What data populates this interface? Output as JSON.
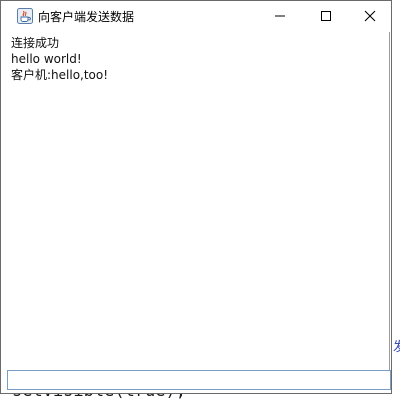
{
  "window": {
    "title": "向客户端发送数据",
    "icon": "java-cup-icon"
  },
  "titlebar_buttons": {
    "minimize": "minimize-icon",
    "maximize": "maximize-icon",
    "close": "close-icon"
  },
  "messages": [
    "连接成功",
    "hello world!",
    "客户机:hello,too!"
  ],
  "input": {
    "value": "",
    "placeholder": ""
  },
  "background": {
    "left_fragment": "I",
    "right_fragment": "发",
    "bottom_fragment": "setVisible(true);"
  },
  "colors": {
    "window_border": "#6a6a6a",
    "input_border": "#7a9fc4",
    "text": "#111111",
    "background": "#ffffff"
  }
}
